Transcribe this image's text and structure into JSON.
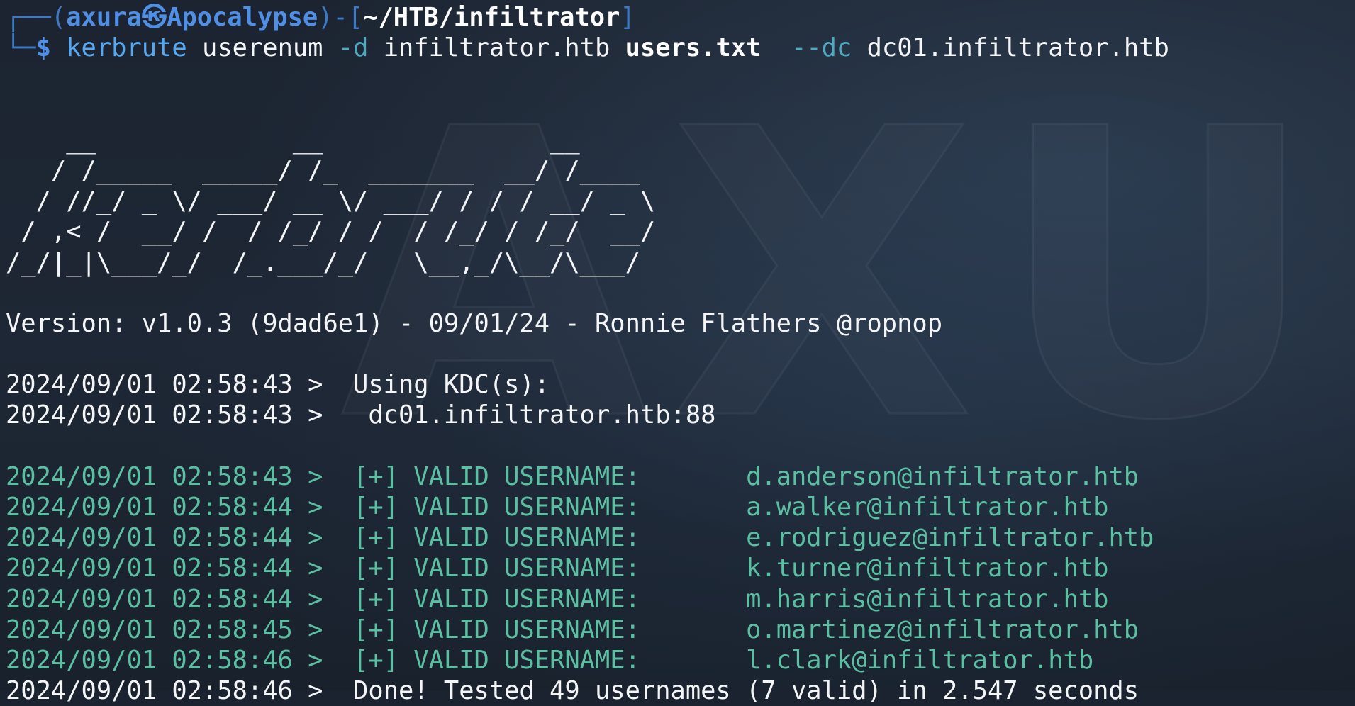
{
  "background": {
    "watermark_text": "AXU"
  },
  "prompt": {
    "frame_left": "┌──(",
    "user": "axura",
    "skull": "㉿",
    "host": "Apocalypse",
    "frame_mid": ")-[",
    "path": "~/HTB/infiltrator",
    "frame_right": "]",
    "corner": "└─",
    "dollar": "$"
  },
  "command": {
    "name": "kerbrute",
    "sub": "userenum",
    "flag_d": "-d",
    "domain": "infiltrator.htb",
    "file": "users.txt",
    "flag_dc": "--dc",
    "dc": "dc01.infiltrator.htb"
  },
  "banner": [
    "    __             __               __     ",
    "   / /_____  _____/ /_  _______  __/ /____ ",
    "  / //_/ _ \\/ ___/ __ \\/ ___/ / / / __/ _ \\",
    " / ,< /  __/ /  / /_/ / /  / /_/ / /_/  __/",
    "/_/|_|\\___/_/  /_.___/_/   \\__,_/\\__/\\___/ "
  ],
  "version_line": "Version: v1.0.3 (9dad6e1) - 09/01/24 - Ronnie Flathers @ropnop",
  "kdc_lines": [
    "2024/09/01 02:58:43 >  Using KDC(s):",
    "2024/09/01 02:58:43 >   dc01.infiltrator.htb:88"
  ],
  "results": [
    {
      "timestamp": "2024/09/01 02:58:43",
      "label": "[+] VALID USERNAME:",
      "user": "d.anderson@infiltrator.htb"
    },
    {
      "timestamp": "2024/09/01 02:58:44",
      "label": "[+] VALID USERNAME:",
      "user": "a.walker@infiltrator.htb"
    },
    {
      "timestamp": "2024/09/01 02:58:44",
      "label": "[+] VALID USERNAME:",
      "user": "e.rodriguez@infiltrator.htb"
    },
    {
      "timestamp": "2024/09/01 02:58:44",
      "label": "[+] VALID USERNAME:",
      "user": "k.turner@infiltrator.htb"
    },
    {
      "timestamp": "2024/09/01 02:58:44",
      "label": "[+] VALID USERNAME:",
      "user": "m.harris@infiltrator.htb"
    },
    {
      "timestamp": "2024/09/01 02:58:45",
      "label": "[+] VALID USERNAME:",
      "user": "o.martinez@infiltrator.htb"
    },
    {
      "timestamp": "2024/09/01 02:58:46",
      "label": "[+] VALID USERNAME:",
      "user": "l.clark@infiltrator.htb"
    }
  ],
  "done_line": "2024/09/01 02:58:46 >  Done! Tested 49 usernames (7 valid) in 2.547 seconds",
  "colors": {
    "background": "#1b2330",
    "prompt_blue": "#4f8fe6",
    "valid_green": "#5bbfa2",
    "text": "#f4f5f7"
  }
}
